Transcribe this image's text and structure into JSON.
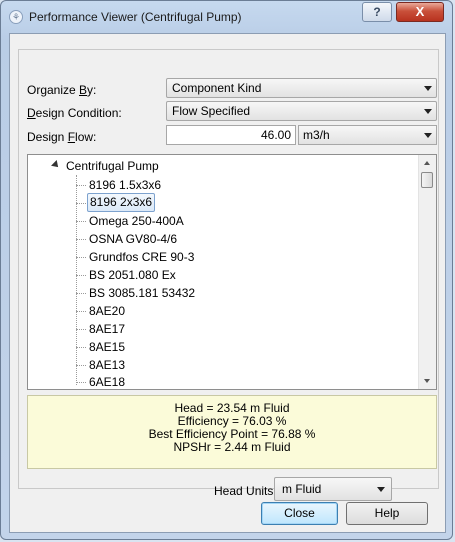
{
  "window": {
    "title": "Performance Viewer (Centrifugal Pump)",
    "help_glyph": "?",
    "close_glyph": "X"
  },
  "form": {
    "organize_by": {
      "label_prefix": "Organize ",
      "label_key": "B",
      "label_suffix": "y:",
      "value": "Component Kind"
    },
    "design_condition": {
      "label_key": "D",
      "label_suffix": "esign Condition:",
      "value": "Flow Specified"
    },
    "design_flow": {
      "label_prefix": "Design ",
      "label_key": "F",
      "label_suffix": "low:",
      "value": "46.00",
      "unit": "m3/h"
    }
  },
  "tree": {
    "root": "Centrifugal Pump",
    "items": [
      "8196 1.5x3x6",
      "8196 2x3x6",
      "Omega 250-400A",
      "OSNA GV80-4/6",
      "Grundfos CRE 90-3",
      "BS 2051.080 Ex",
      "BS 3085.181 53432",
      "8AE20",
      "8AE17",
      "8AE15",
      "8AE13",
      "6AE18"
    ],
    "selected_index": 1
  },
  "info": {
    "head": "Head = 23.54 m Fluid",
    "efficiency": "Efficiency = 76.03 %",
    "bep": "Best Efficiency Point = 76.88 %",
    "npshr": "NPSHr = 2.44 m Fluid"
  },
  "head_units": {
    "label": "Head Units",
    "value": "m Fluid"
  },
  "buttons": {
    "close": "Close",
    "help": "Help"
  },
  "colors": {
    "info_background": "#fbfbd9",
    "selection_border": "#7da2ce",
    "close_caption": "#c9503a"
  },
  "icons": [
    "app-icon",
    "help-icon",
    "close-icon",
    "dropdown-arrow-icon",
    "tree-collapse-icon",
    "scroll-up-icon",
    "scroll-down-icon"
  ]
}
